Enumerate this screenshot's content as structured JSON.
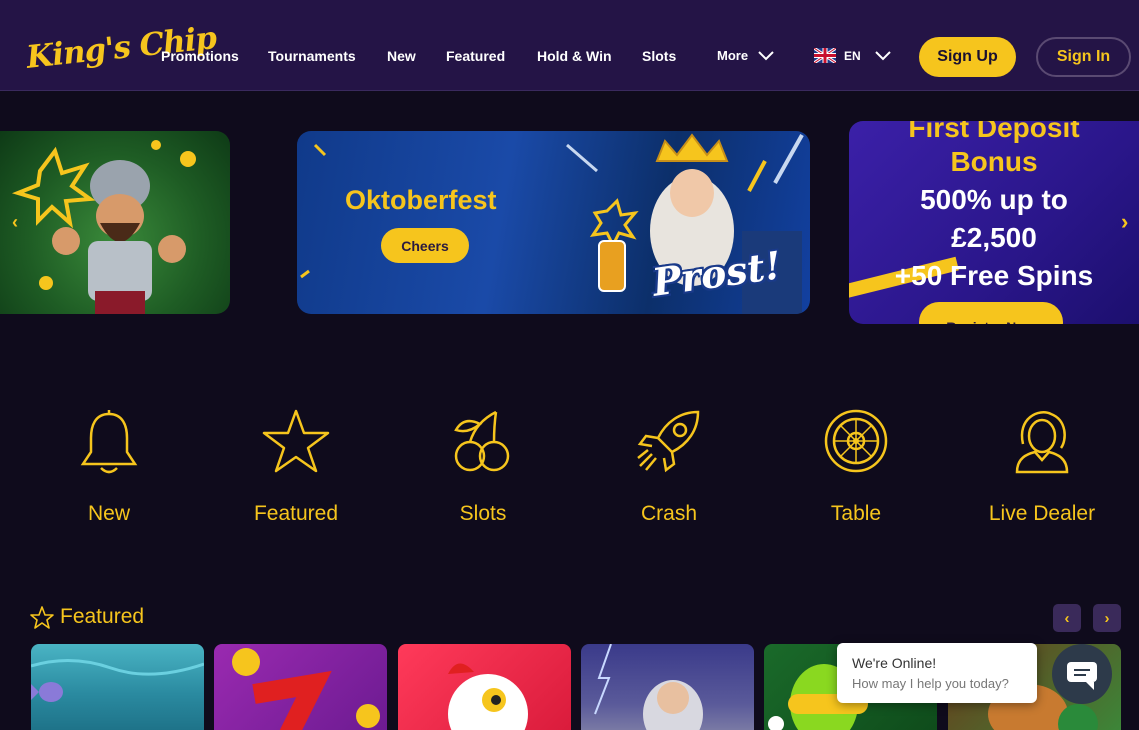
{
  "header": {
    "logo": "King's Chip",
    "nav": [
      "Promotions",
      "Tournaments",
      "New",
      "Featured",
      "Hold & Win",
      "Slots"
    ],
    "more_label": "More",
    "lang_code": "EN",
    "signup_label": "Sign Up",
    "signin_label": "Sign In"
  },
  "banners": {
    "oktoberfest": {
      "title": "Oktoberfest",
      "button": "Cheers",
      "overlay_text": "Prost!"
    },
    "deposit": {
      "line1": "First Deposit",
      "line2": "Bonus",
      "line3": "500% up to",
      "line4": "£2,500",
      "line5": "+50 Free Spins",
      "button": "Register Now"
    }
  },
  "categories": [
    {
      "label": "New",
      "icon": "bell-icon"
    },
    {
      "label": "Featured",
      "icon": "star-icon"
    },
    {
      "label": "Slots",
      "icon": "cherries-icon"
    },
    {
      "label": "Crash",
      "icon": "rocket-icon"
    },
    {
      "label": "Table",
      "icon": "roulette-icon"
    },
    {
      "label": "Live Dealer",
      "icon": "dealer-icon"
    }
  ],
  "featured": {
    "title": "Featured"
  },
  "chat": {
    "line1": "We're Online!",
    "line2": "How may I help you today?"
  },
  "colors": {
    "accent": "#f6c51d",
    "header_bg": "#241446",
    "page_bg": "#0f0b1c"
  }
}
